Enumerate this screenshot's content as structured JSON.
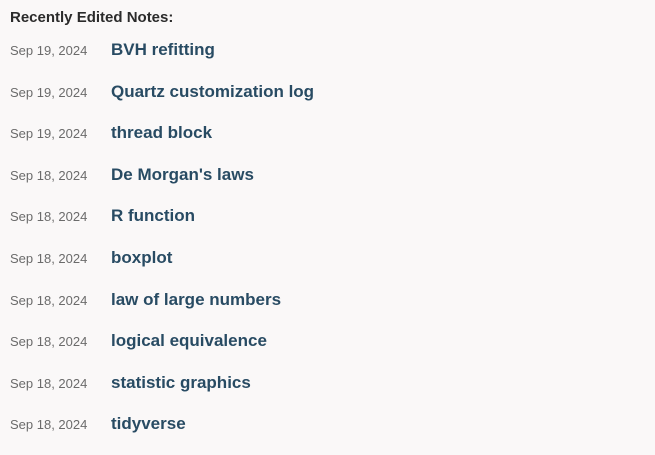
{
  "heading": "Recently Edited Notes:",
  "notes": [
    {
      "date": "Sep 19, 2024",
      "title": "BVH refitting"
    },
    {
      "date": "Sep 19, 2024",
      "title": "Quartz customization log"
    },
    {
      "date": "Sep 19, 2024",
      "title": "thread block"
    },
    {
      "date": "Sep 18, 2024",
      "title": "De Morgan's laws"
    },
    {
      "date": "Sep 18, 2024",
      "title": "R function"
    },
    {
      "date": "Sep 18, 2024",
      "title": "boxplot"
    },
    {
      "date": "Sep 18, 2024",
      "title": "law of large numbers"
    },
    {
      "date": "Sep 18, 2024",
      "title": "logical equivalence"
    },
    {
      "date": "Sep 18, 2024",
      "title": "statistic graphics"
    },
    {
      "date": "Sep 18, 2024",
      "title": "tidyverse"
    }
  ],
  "colors": {
    "background": "#faf8f8",
    "heading": "#2b2b2b",
    "date": "#6b6b6b",
    "link": "#284b63"
  }
}
